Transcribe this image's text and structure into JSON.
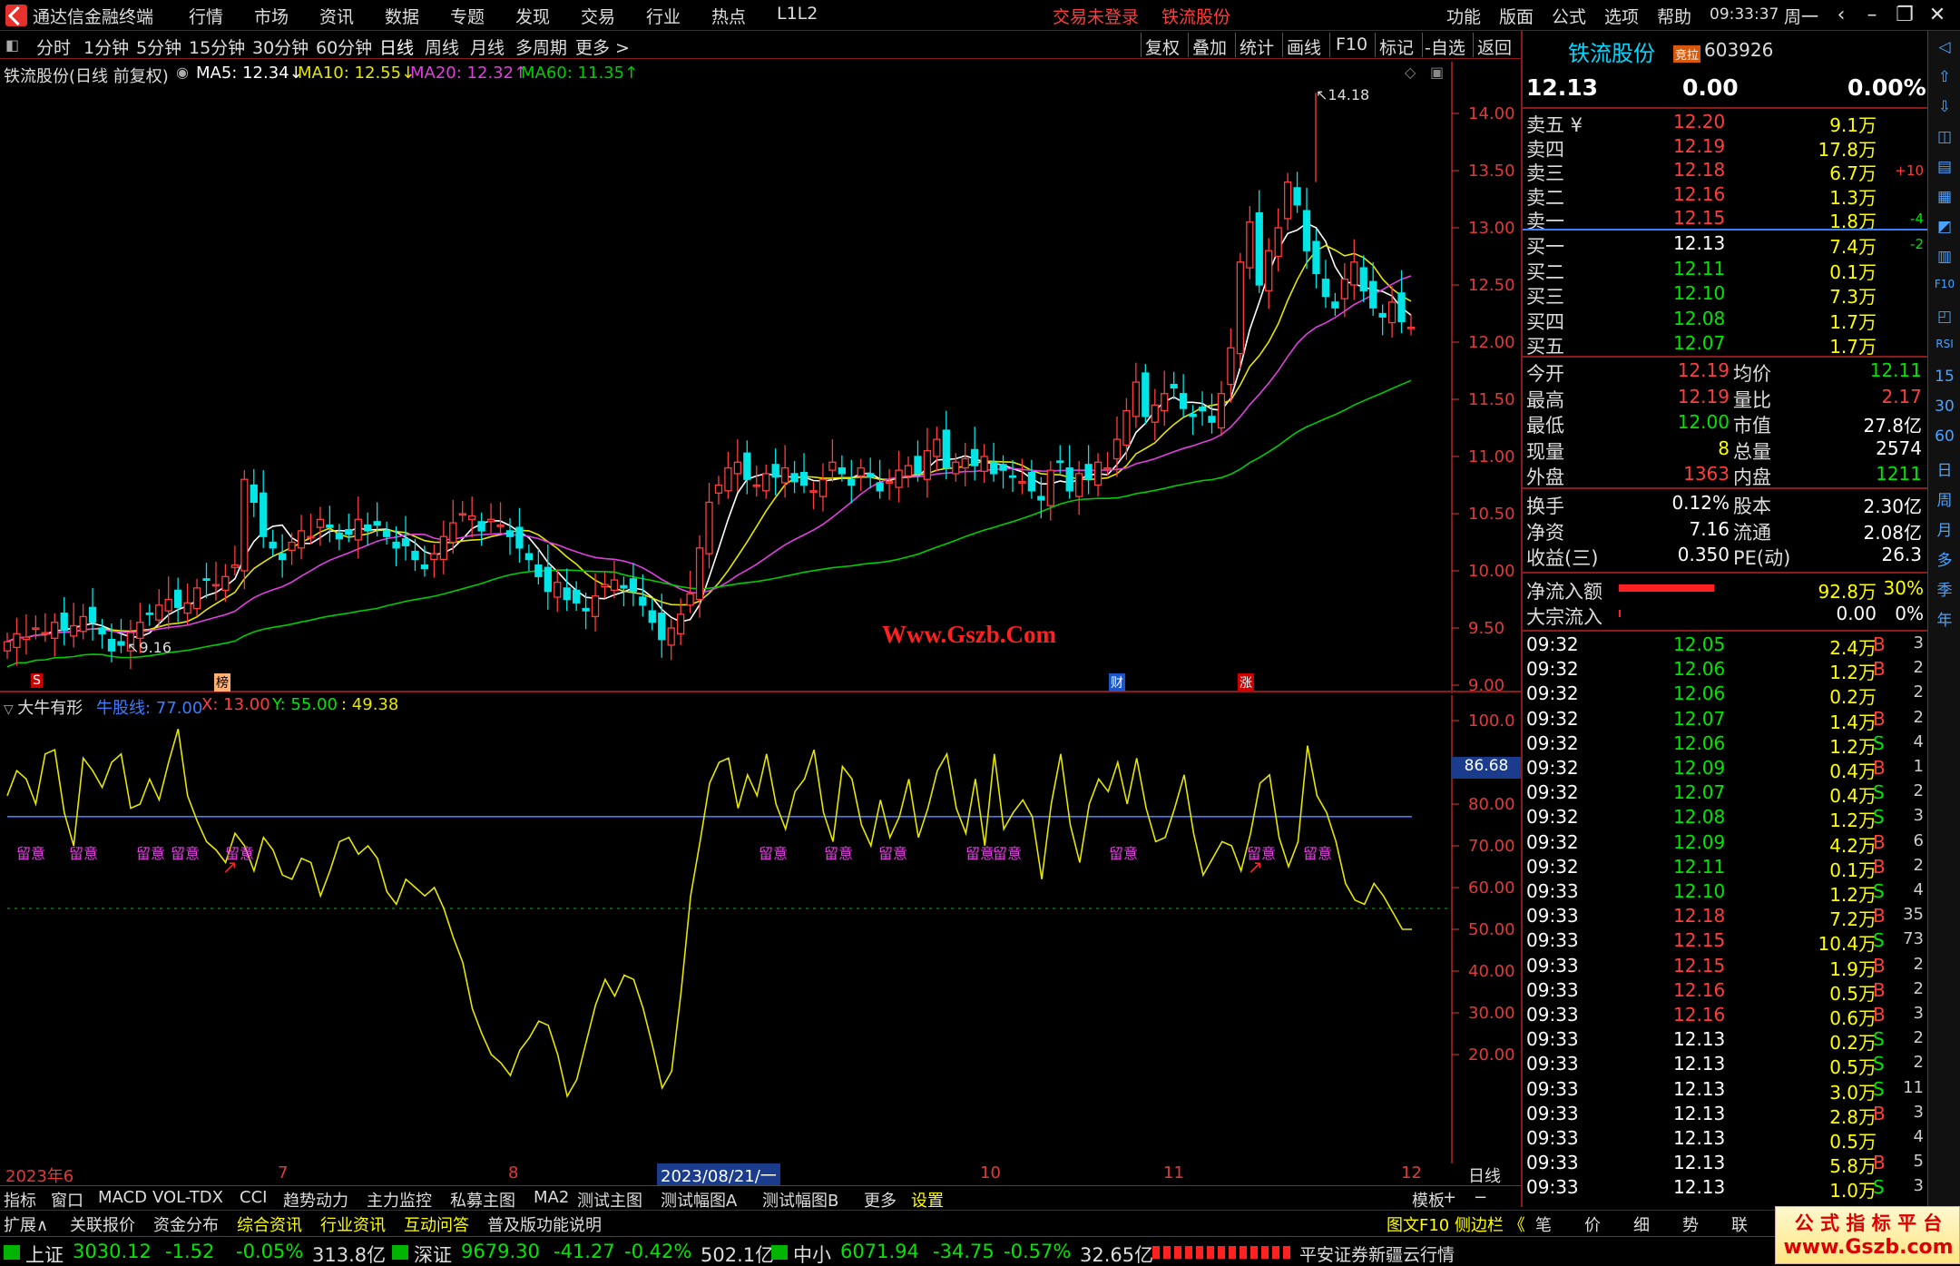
{
  "app": {
    "title": "通达信金融终端",
    "menu": [
      "行情",
      "市场",
      "资讯",
      "数据",
      "专题",
      "发现",
      "交易",
      "行业",
      "热点",
      "L1L2"
    ],
    "login_status": "交易未登录",
    "stock_name_top": "铁流股份",
    "right_menu": [
      "功能",
      "版面",
      "公式",
      "选项",
      "帮助"
    ],
    "clock": "09:33:37",
    "weekday": "周一"
  },
  "period_tabs": [
    "分时",
    "1分钟",
    "5分钟",
    "15分钟",
    "30分钟",
    "60分钟",
    "日线",
    "周线",
    "月线",
    "多周期",
    "更多 >"
  ],
  "toolbar_right": [
    "复权",
    "叠加",
    "统计",
    "画线",
    "F10",
    "标记",
    "-自选",
    "返回"
  ],
  "chart_legend": {
    "title": "铁流股份(日线 前复权)",
    "ma5": "MA5: 12.34↓",
    "ma10": "MA10: 12.55↓",
    "ma20": "MA20: 12.32↑",
    "ma60": "MA60: 11.35↑"
  },
  "price_axis": [
    "14.00",
    "13.50",
    "13.00",
    "12.50",
    "12.00",
    "11.50",
    "11.00",
    "10.50",
    "10.00",
    "9.50",
    "9.00"
  ],
  "price_annotations": {
    "high": "14.18",
    "low": "9.16"
  },
  "watermark": "Www.Gszb.Com",
  "event_markers": [
    "S",
    "榜",
    "财",
    "涨"
  ],
  "indicator": {
    "name": "大牛有形",
    "bull": "牛股线: 77.00",
    "x": "X: 13.00",
    "y": "Y: 55.00",
    "val": ": 49.38",
    "current": "86.68",
    "signal_label": "留意",
    "axis": [
      "100.0",
      "80.00",
      "70.00",
      "60.00",
      "50.00",
      "40.00",
      "30.00",
      "20.00"
    ]
  },
  "date_axis": [
    "2023年6",
    "7",
    "8",
    "2023/08/21/一",
    "10",
    "11",
    "12"
  ],
  "date_axis_right": "日线",
  "quote": {
    "code": "603926",
    "name": "铁流股份",
    "badge": "竞拉",
    "price": "12.13",
    "change": "0.00",
    "pct": "0.00%",
    "asks": [
      {
        "label": "卖五",
        "sym": "¥",
        "price": "12.20",
        "vol": "9.1万",
        "ex": ""
      },
      {
        "label": "卖四",
        "sym": "",
        "price": "12.19",
        "vol": "17.8万",
        "ex": ""
      },
      {
        "label": "卖三",
        "sym": "",
        "price": "12.18",
        "vol": "6.7万",
        "ex": "+10"
      },
      {
        "label": "卖二",
        "sym": "",
        "price": "12.16",
        "vol": "1.3万",
        "ex": ""
      },
      {
        "label": "卖一",
        "sym": "",
        "price": "12.15",
        "vol": "1.8万",
        "ex": "-4"
      }
    ],
    "bids": [
      {
        "label": "买一",
        "price": "12.13",
        "vol": "7.4万",
        "ex": "-2"
      },
      {
        "label": "买二",
        "price": "12.11",
        "vol": "0.1万",
        "ex": ""
      },
      {
        "label": "买三",
        "price": "12.10",
        "vol": "7.3万",
        "ex": ""
      },
      {
        "label": "买四",
        "price": "12.08",
        "vol": "1.7万",
        "ex": ""
      },
      {
        "label": "买五",
        "price": "12.07",
        "vol": "1.7万",
        "ex": ""
      }
    ],
    "stats": [
      {
        "l1": "今开",
        "v1": "12.19",
        "l2": "均价",
        "v2": "12.11"
      },
      {
        "l1": "最高",
        "v1": "12.19",
        "l2": "量比",
        "v2": "2.17"
      },
      {
        "l1": "最低",
        "v1": "12.00",
        "l2": "市值",
        "v2": "27.8亿"
      },
      {
        "l1": "现量",
        "v1": "8",
        "l2": "总量",
        "v2": "2574"
      },
      {
        "l1": "外盘",
        "v1": "1363",
        "l2": "内盘",
        "v2": "1211"
      }
    ],
    "stats2": [
      {
        "l1": "换手",
        "v1": "0.12%",
        "l2": "股本",
        "v2": "2.30亿"
      },
      {
        "l1": "净资",
        "v1": "7.16",
        "l2": "流通",
        "v2": "2.08亿"
      },
      {
        "l1": "收益(三)",
        "v1": "0.350",
        "l2": "PE(动)",
        "v2": "26.3"
      }
    ],
    "flow": [
      {
        "label": "净流入额",
        "val": "92.8万",
        "pct": "30%",
        "ratio": 0.3
      },
      {
        "label": "大宗流入",
        "val": "0.00",
        "pct": "0%",
        "ratio": 0
      }
    ]
  },
  "ticks": [
    [
      "09:32",
      "12.05",
      "2.4万",
      "B",
      "3"
    ],
    [
      "09:32",
      "12.06",
      "1.2万",
      "B",
      "2"
    ],
    [
      "09:32",
      "12.06",
      "0.2万",
      "",
      "2"
    ],
    [
      "09:32",
      "12.07",
      "1.4万",
      "B",
      "2"
    ],
    [
      "09:32",
      "12.06",
      "1.2万",
      "S",
      "4"
    ],
    [
      "09:32",
      "12.09",
      "0.4万",
      "B",
      "1"
    ],
    [
      "09:32",
      "12.07",
      "0.4万",
      "S",
      "2"
    ],
    [
      "09:32",
      "12.08",
      "1.2万",
      "S",
      "3"
    ],
    [
      "09:32",
      "12.09",
      "4.2万",
      "B",
      "6"
    ],
    [
      "09:32",
      "12.11",
      "0.1万",
      "B",
      "2"
    ],
    [
      "09:33",
      "12.10",
      "1.2万",
      "S",
      "4"
    ],
    [
      "09:33",
      "12.18",
      "7.2万",
      "B",
      "35"
    ],
    [
      "09:33",
      "12.15",
      "10.4万",
      "S",
      "73"
    ],
    [
      "09:33",
      "12.15",
      "1.9万",
      "B",
      "2"
    ],
    [
      "09:33",
      "12.16",
      "0.5万",
      "B",
      "2"
    ],
    [
      "09:33",
      "12.16",
      "0.6万",
      "B",
      "3"
    ],
    [
      "09:33",
      "12.13",
      "0.2万",
      "S",
      "2"
    ],
    [
      "09:33",
      "12.13",
      "0.5万",
      "S",
      "2"
    ],
    [
      "09:33",
      "12.13",
      "3.0万",
      "S",
      "11"
    ],
    [
      "09:33",
      "12.13",
      "2.8万",
      "B",
      "3"
    ],
    [
      "09:33",
      "12.13",
      "0.5万",
      "",
      "4"
    ],
    [
      "09:33",
      "12.13",
      "5.8万",
      "B",
      "5"
    ],
    [
      "09:33",
      "12.13",
      "1.0万",
      "S",
      "3"
    ]
  ],
  "bottom_tabs1": [
    "指标",
    "窗口",
    "MACD",
    "VOL-TDX",
    "CCI",
    "趋势动力",
    "主力监控",
    "私募主图",
    "MA2",
    "测试主图",
    "测试幅图A",
    "测试幅图B",
    "更多",
    "设置"
  ],
  "bottom_tabs1_right": [
    "模板",
    "+",
    "−"
  ],
  "bottom_tabs2": [
    "扩展∧",
    "关联报价",
    "资金分布",
    "综合资讯",
    "行业资讯",
    "互动问答",
    "普及版功能说明"
  ],
  "bottom_tabs2_right": "图文F10 侧边栏 《",
  "bottom_tabs3": [
    "笔",
    "价",
    "细",
    "势",
    "联"
  ],
  "indices": [
    {
      "name": "上证",
      "val": "3030.12",
      "chg": "-1.52",
      "pct": "-0.05%",
      "amt": "313.8亿"
    },
    {
      "name": "深证",
      "val": "9679.30",
      "chg": "-41.27",
      "pct": "-0.42%",
      "amt": "502.1亿"
    },
    {
      "name": "中小",
      "val": "6071.94",
      "chg": "-34.75",
      "pct": "-0.57%",
      "amt": "32.65亿"
    }
  ],
  "broker": "平安证券新疆云行情",
  "corner_watermark": {
    "line1": "公 式 指 标 平 台",
    "line2": "www.Gszb.com"
  },
  "sidebar_icons": [
    "◁",
    "⇧",
    "⇩",
    "◫",
    "▤",
    "▦",
    "◩",
    "▥",
    "F10",
    "◰",
    "RSI",
    "15",
    "30",
    "60",
    "日",
    "周",
    "月",
    "多",
    "季",
    "年"
  ],
  "colors": {
    "up": "#ff3d3d",
    "down": "#00e6e6",
    "ma5": "#ffffff",
    "ma10": "#e6e600",
    "ma20": "#e040e0",
    "ma60": "#00cc00",
    "indicator": "#e6e600",
    "bull_line": "#3b7dff",
    "grid": "#8b1a1a"
  }
}
